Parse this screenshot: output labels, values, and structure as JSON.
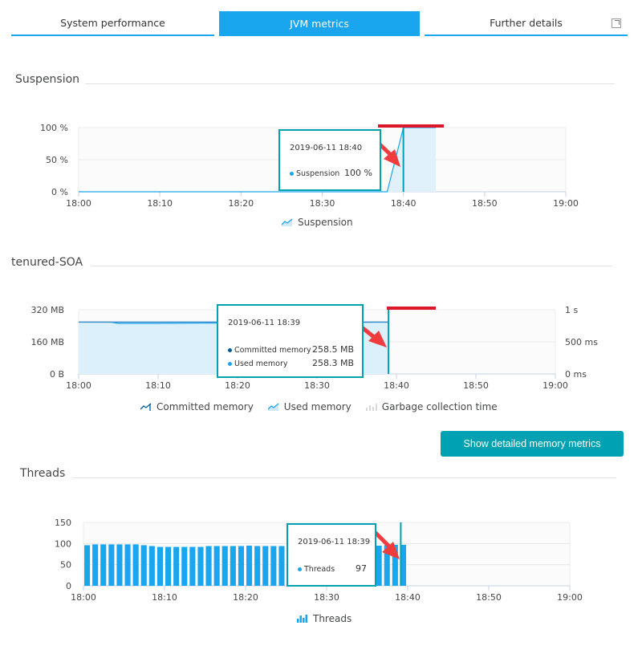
{
  "tabs": [
    {
      "label": "System performance",
      "active": false
    },
    {
      "label": "JVM metrics",
      "active": true
    },
    {
      "label": "Further details",
      "active": false,
      "icon": "external-link-icon"
    }
  ],
  "colors": {
    "accent": "#1aa5ef",
    "teal": "#00a1b2",
    "committed": "#005a9e",
    "used": "#1aa5ef",
    "annotation_red": "#dc172a",
    "arrow_red": "#f03c3c"
  },
  "suspension": {
    "title": "Suspension",
    "tooltip": {
      "timestamp": "2019-06-11 18:40",
      "series": "Suspension",
      "value": "100 %"
    },
    "legend": [
      {
        "label": "Suspension",
        "icon": "area-chart-icon"
      }
    ]
  },
  "memory": {
    "title": "tenured-SOA",
    "tooltip": {
      "timestamp": "2019-06-11 18:39",
      "rows": [
        {
          "series": "Committed memory",
          "value": "258.5 MB"
        },
        {
          "series": "Used memory",
          "value": "258.3 MB"
        }
      ]
    },
    "legend": [
      {
        "label": "Committed memory",
        "icon": "line-chart-icon"
      },
      {
        "label": "Used memory",
        "icon": "area-chart-icon"
      },
      {
        "label": "Garbage collection time",
        "icon": "bar-chart-icon"
      }
    ],
    "button_label": "Show detailed memory metrics"
  },
  "threads": {
    "title": "Threads",
    "tooltip": {
      "timestamp": "2019-06-11 18:39",
      "series": "Threads",
      "value": "97"
    },
    "legend": [
      {
        "label": "Threads",
        "icon": "bar-chart-icon"
      }
    ]
  },
  "chart_data": [
    {
      "type": "area",
      "title": "Suspension",
      "x_ticks": [
        "18:00",
        "18:10",
        "18:20",
        "18:30",
        "18:40",
        "18:50",
        "19:00"
      ],
      "y_ticks": [
        "0 %",
        "50 %",
        "100 %"
      ],
      "ylim": [
        0,
        100
      ],
      "xlim_minutes": [
        0,
        60
      ],
      "series": [
        {
          "name": "Suspension",
          "x_minutes": [
            0,
            38,
            40,
            44
          ],
          "values": [
            0,
            0,
            100,
            100
          ]
        }
      ],
      "highlight_minute": 40
    },
    {
      "type": "area",
      "title": "tenured-SOA",
      "x_ticks": [
        "18:00",
        "18:10",
        "18:20",
        "18:30",
        "18:40",
        "18:50",
        "19:00"
      ],
      "y_ticks": [
        "0 B",
        "160 MB",
        "320 MB"
      ],
      "y2_ticks": [
        "0 ms",
        "500 ms",
        "1 s"
      ],
      "ylim": [
        0,
        320
      ],
      "y2lim": [
        0,
        1000
      ],
      "xlim_minutes": [
        0,
        60
      ],
      "series": [
        {
          "name": "Committed memory",
          "x_minutes": [
            0,
            4,
            5,
            10,
            20,
            30,
            39
          ],
          "values": [
            258.5,
            258.5,
            258.5,
            258.5,
            258.5,
            258.5,
            258.5
          ]
        },
        {
          "name": "Used memory",
          "x_minutes": [
            0,
            4,
            5,
            10,
            20,
            30,
            39
          ],
          "values": [
            258.3,
            258.3,
            252,
            252,
            254,
            256,
            258.3
          ]
        },
        {
          "name": "Garbage collection time",
          "x_minutes": [],
          "values": []
        }
      ],
      "highlight_minute": 39
    },
    {
      "type": "bar",
      "title": "Threads",
      "x_ticks": [
        "18:00",
        "18:10",
        "18:20",
        "18:30",
        "18:40",
        "18:50",
        "19:00"
      ],
      "y_ticks": [
        "0",
        "50",
        "100",
        "150"
      ],
      "ylim": [
        0,
        150
      ],
      "xlim_minutes": [
        0,
        60
      ],
      "series": [
        {
          "name": "Threads",
          "values": [
            96,
            98,
            98,
            98,
            98,
            98,
            98,
            96,
            94,
            92,
            92,
            92,
            92,
            92,
            92,
            94,
            94,
            94,
            94,
            94,
            95,
            94,
            94,
            94,
            94,
            94,
            94,
            94,
            94,
            94,
            94,
            94,
            94,
            94,
            94,
            94,
            95,
            96,
            97,
            97
          ]
        }
      ],
      "highlight_minute": 39
    }
  ]
}
